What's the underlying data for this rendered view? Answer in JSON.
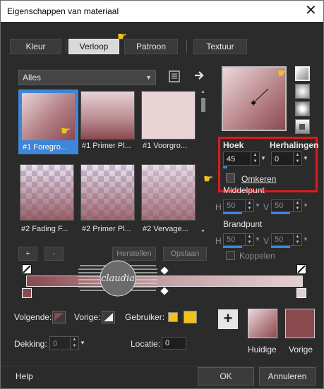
{
  "title": "Eigenschappen van materiaal",
  "tabs": [
    {
      "label": "Kleur"
    },
    {
      "label": "Verloop"
    },
    {
      "label": "Patroon"
    },
    {
      "label": "Textuur"
    }
  ],
  "category_dropdown": "Alles",
  "gradients": [
    {
      "label": "#1 Foregro..."
    },
    {
      "label": "#1 Primer Pl..."
    },
    {
      "label": "#1 Voorgro..."
    },
    {
      "label": "#2 Fading F..."
    },
    {
      "label": "#2 Primer Pl..."
    },
    {
      "label": "#2 Vervage..."
    }
  ],
  "controls": {
    "add": "+",
    "remove": "-",
    "restore": "Herstellen",
    "save": "Opslaan"
  },
  "angle": {
    "label": "Hoek",
    "value": "45"
  },
  "repeats": {
    "label": "Herhalingen",
    "value": "0"
  },
  "invert": {
    "label": "Omkeren"
  },
  "center": {
    "label": "Middelpunt",
    "h_label": "H",
    "h_value": "50",
    "v_label": "V",
    "v_value": "50"
  },
  "focal": {
    "label": "Brandpunt",
    "h_label": "H",
    "h_value": "50",
    "v_label": "V",
    "v_value": "50"
  },
  "link": {
    "label": "Koppelen"
  },
  "next": {
    "label": "Volgende:"
  },
  "prev": {
    "label": "Vorige:"
  },
  "user": {
    "label": "Gebruiker:"
  },
  "opacity": {
    "label": "Dekking:",
    "value": "0"
  },
  "location": {
    "label": "Locatie:",
    "value": "0"
  },
  "current_label": "Huidige",
  "previous_label": "Vorige",
  "help": "Help",
  "ok": "OK",
  "cancel": "Annuleren",
  "colors": {
    "dark_rose": "#8a4a50",
    "light_rose": "#e5cfd2",
    "highlight_red": "#e0191b",
    "selection_blue": "#3d86d8",
    "user_yellow": "#f2c21c"
  }
}
